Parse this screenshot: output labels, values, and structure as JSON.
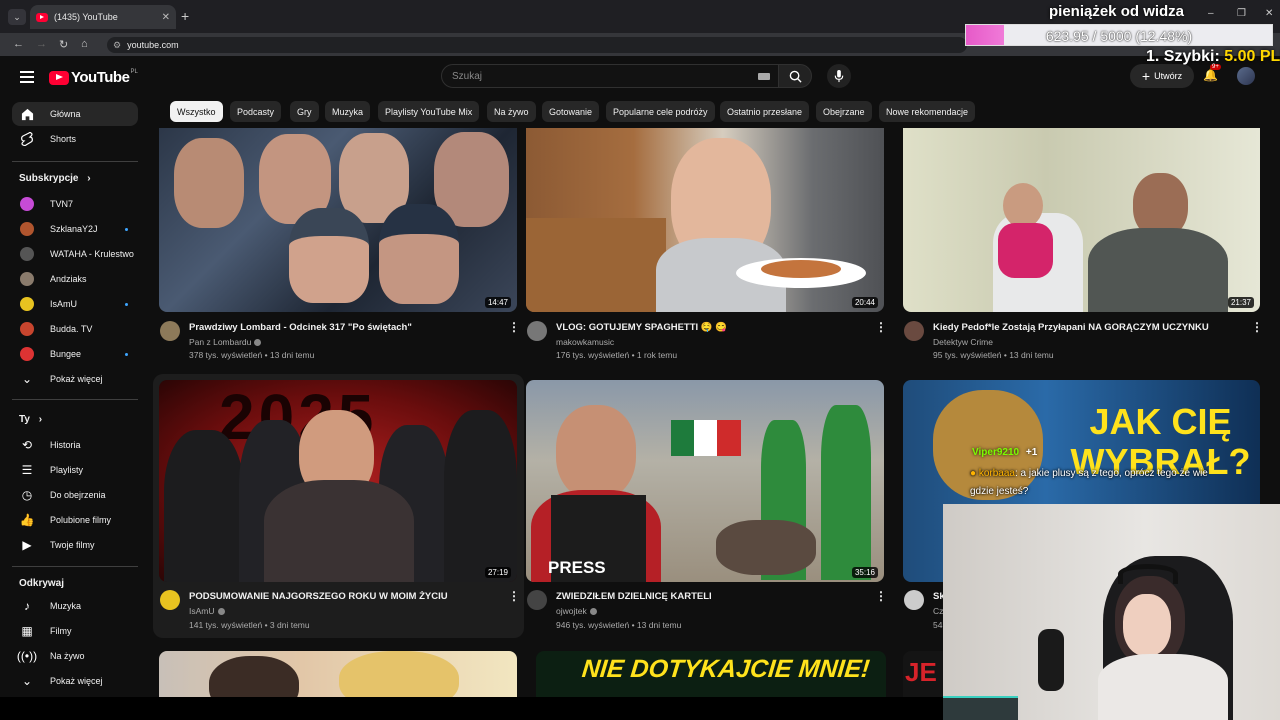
{
  "browser": {
    "tab_title": "(1435) YouTube",
    "new_tab": "+",
    "url": "youtube.com",
    "win_minimize": "–",
    "win_restore": "❐",
    "win_close": "✕"
  },
  "overlay": {
    "donation_title": "pieniążek od widza",
    "donation_progress": "623.95 / 5000 (12.48%)",
    "donation_fraction": 0.1248,
    "top_donor_label": "1. Szybki:",
    "top_donor_amount": "5.00 PLN",
    "chat": [
      {
        "user": "Viper9210",
        "text": "+1"
      },
      {
        "user": "korbaaa",
        "text": ": a jakie plusy są z tego, oprócz tego że wie"
      },
      {
        "text": "gdzie jesteś?"
      }
    ]
  },
  "header": {
    "logo_text": "YouTube",
    "country": "PL",
    "search_placeholder": "Szukaj",
    "create_label": "Utwórz",
    "notifications_badge": "9+"
  },
  "sidebar": {
    "main": [
      {
        "label": "Główna",
        "icon": "home-icon",
        "active": true
      },
      {
        "label": "Shorts",
        "icon": "shorts-icon"
      }
    ],
    "subscriptions_heading": "Subskrypcje",
    "subscriptions": [
      {
        "label": "TVN7",
        "color": "#c64bd6",
        "new": false
      },
      {
        "label": "SzklanaY2J",
        "color": "#b0552e",
        "new": true
      },
      {
        "label": "WATAHA - Krulestwo",
        "color": "#444",
        "new": false
      },
      {
        "label": "Andziaks",
        "color": "#8a7b6c",
        "new": false
      },
      {
        "label": "IsAmU",
        "color": "#e8c320",
        "new": true
      },
      {
        "label": "Budda. TV",
        "color": "#c8452e",
        "new": false
      },
      {
        "label": "Bungee",
        "color": "#d33",
        "new": true
      }
    ],
    "show_more_1": "Pokaż więcej",
    "you_heading": "Ty",
    "you_items": [
      {
        "label": "Historia",
        "icon": "history-icon"
      },
      {
        "label": "Playlisty",
        "icon": "playlist-icon"
      },
      {
        "label": "Do obejrzenia",
        "icon": "watch-later-icon"
      },
      {
        "label": "Polubione filmy",
        "icon": "thumbs-up-icon"
      },
      {
        "label": "Twoje filmy",
        "icon": "your-videos-icon"
      }
    ],
    "explore_heading": "Odkrywaj",
    "explore_items": [
      {
        "label": "Muzyka",
        "icon": "music-icon"
      },
      {
        "label": "Filmy",
        "icon": "film-icon"
      },
      {
        "label": "Na żywo",
        "icon": "live-icon"
      }
    ],
    "show_more_2": "Pokaż więcej"
  },
  "chips": [
    "Wszystko",
    "Podcasty",
    "Gry",
    "Muzyka",
    "Playlisty YouTube Mix",
    "Na żywo",
    "Gotowanie",
    "Popularne cele podróży",
    "Ostatnio przesłane",
    "Obejrzane",
    "Nowe rekomendacje"
  ],
  "videos": [
    {
      "title": "Prawdziwy Lombard - Odcinek 317 \"Po świętach\"",
      "channel": "Pan z Lombardu",
      "meta": "378 tys. wyświetleń • 13 dni temu",
      "duration": "14:47",
      "verified": true
    },
    {
      "title": "VLOG: GOTUJEMY SPAGHETTI 🤤 😋",
      "channel": "makowkamusic",
      "meta": "176 tys. wyświetleń • 1 rok temu",
      "duration": "20:44",
      "verified": false
    },
    {
      "title": "Kiedy Pedof*le Zostają Przyłapani NA GORĄCZYM UCZYNKU",
      "channel": "Detektyw Crime",
      "meta": "95 tys. wyświetleń • 13 dni temu",
      "duration": "21:37",
      "verified": false
    },
    {
      "title": "PODSUMOWANIE NAJGORSZEGO ROKU W MOIM ŻYCIU",
      "channel": "IsAmU",
      "meta": "141 tys. wyświetleń • 3 dni temu",
      "duration": "27:19",
      "verified": true
    },
    {
      "title": "ZWIEDZIŁEM DZIELNICĘ KARTELI",
      "channel": "ojwojtek",
      "meta": "946 tys. wyświetleń • 13 dni temu",
      "duration": "35:16",
      "verified": true
    },
    {
      "title": "Sk",
      "channel": "Cz",
      "meta": "54",
      "duration": "",
      "verified": false
    }
  ],
  "thumb_text": {
    "year": "2025",
    "press": "PRESS",
    "cat": "JAK CIĘ WYBRAŁ?",
    "nie": "NIE DOTYKAJCIE MNIE!",
    "je": "JE"
  }
}
